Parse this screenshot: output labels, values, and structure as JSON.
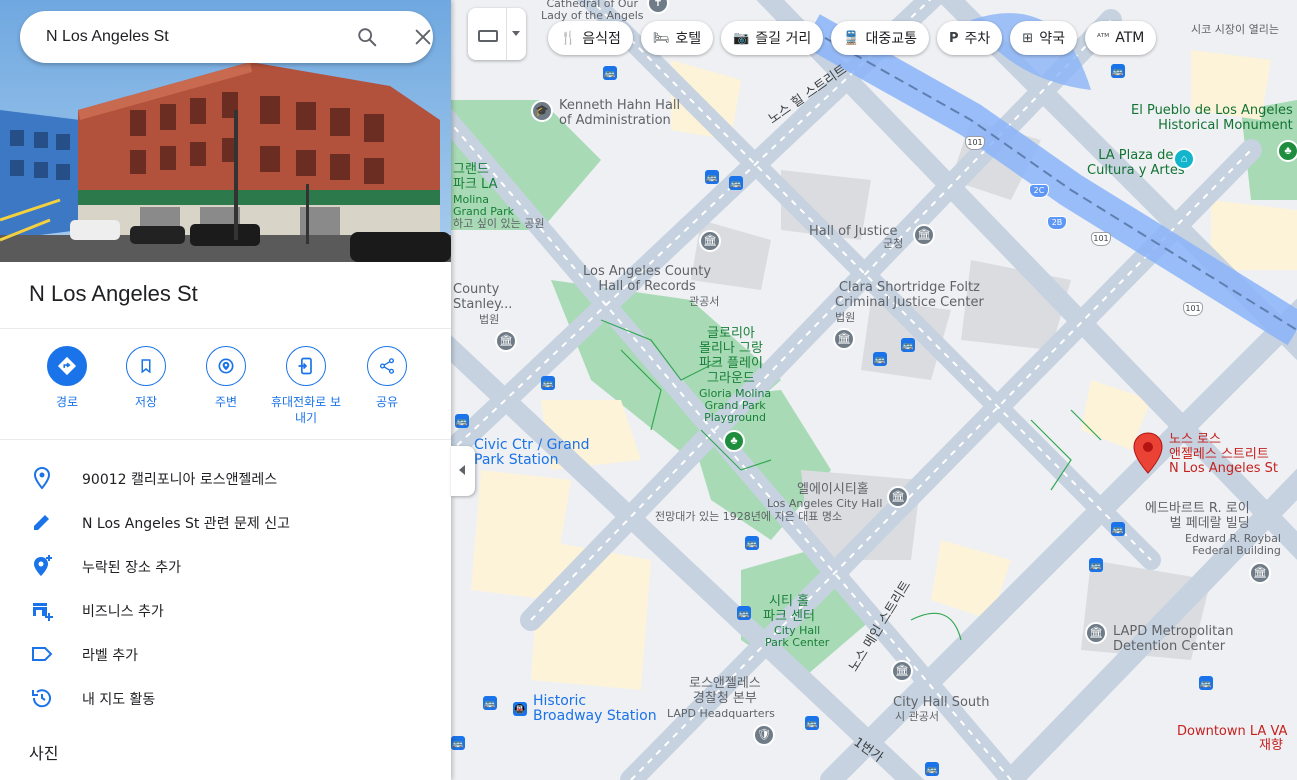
{
  "search": {
    "value": "N Los Angeles St"
  },
  "place": {
    "title": "N Los Angeles St"
  },
  "actions": [
    {
      "label": "경로",
      "icon": "directions-icon"
    },
    {
      "label": "저장",
      "icon": "bookmark-icon"
    },
    {
      "label": "주변",
      "icon": "nearby-icon"
    },
    {
      "label": "휴대전화로 보내기",
      "icon": "send-to-phone-icon"
    },
    {
      "label": "공유",
      "icon": "share-icon"
    }
  ],
  "info": [
    {
      "text": "90012 캘리포니아 로스앤젤레스",
      "icon": "location-pin-icon"
    },
    {
      "text": "N Los Angeles St 관련 문제 신고",
      "icon": "edit-pencil-icon"
    },
    {
      "text": "누락된 장소 추가",
      "icon": "add-place-icon"
    },
    {
      "text": "비즈니스 추가",
      "icon": "add-business-icon"
    },
    {
      "text": "라벨 추가",
      "icon": "label-icon"
    },
    {
      "text": "내 지도 활동",
      "icon": "history-icon"
    }
  ],
  "photos_heading": "사진",
  "chips": [
    {
      "label": "음식점",
      "icon": "restaurant-icon",
      "glyph": "🍴"
    },
    {
      "label": "호텔",
      "icon": "hotel-icon",
      "glyph": "🛏"
    },
    {
      "label": "즐길 거리",
      "icon": "camera-icon",
      "glyph": "📷"
    },
    {
      "label": "대중교통",
      "icon": "transit-icon",
      "glyph": "🚆"
    },
    {
      "label": "주차",
      "icon": "parking-icon",
      "glyph": "P"
    },
    {
      "label": "약국",
      "icon": "pharmacy-icon",
      "glyph": "⊞"
    },
    {
      "label": "ATM",
      "icon": "atm-icon",
      "glyph": "ᴬᵀᴹ"
    }
  ],
  "map": {
    "labels": {
      "cathedral": "Cathedral of Our\nLady of the Angels",
      "kenneth_hahn": "Kenneth Hahn Hall\nof Administration",
      "el_pueblo": "El Pueblo de Los Angeles\nHistorical Monument",
      "la_plaza": "LA Plaza de\nCultura y Artes",
      "hall_of_justice": "Hall of Justice",
      "hall_of_justice_sub": "군청",
      "clara_shortridge": "Clara Shortridge Foltz\nCriminal Justice Center",
      "clara_sub": "법원",
      "la_county_records": "Los Angeles County\nHall of Records",
      "la_county_records_sub": "관공서",
      "grand_park": "그랜드\n파크 LA",
      "grand_park_en": "Molina\nGrand Park",
      "grand_park_note": "하고 싶이 있는 공원",
      "county_stanley": "County\nStanley...",
      "county_stanley_sub": "법원",
      "gloria_molina_kr": "글로리아\n몰리나 그랑\n파크 플레이\n그라운드",
      "gloria_molina_en": "Gloria Molina\nGrand Park\nPlayground",
      "civic_ctr": "Civic Ctr / Grand\nPark Station",
      "la_city_hall_kr": "엘에이시티홀",
      "la_city_hall_en": "Los Angeles City Hall",
      "la_city_hall_note": "전망대가 있는 1928년에 지은 대표 명소",
      "n_los_angeles_kr": "노스 로스\n앤젤레스 스트리트",
      "n_los_angeles_en": "N Los Angeles St",
      "edward_roybal_kr": "에드바르트 R. 로이\n벌 페데랄 빌딩",
      "edward_roybal_en": "Edward R. Roybal\nFederal Building",
      "city_hall_park_kr": "시티 홀\n파크 센터",
      "city_hall_park_en": "City Hall\nPark Center",
      "lapd_metro": "LAPD Metropolitan\nDetention Center",
      "lapd_hq_kr": "로스앤젤레스\n경찰청 본부",
      "lapd_hq_en": "LAPD Headquarters",
      "historic_broadway": "Historic\nBroadway Station",
      "city_hall_south": "City Hall South",
      "city_hall_south_sub": "시 관공서",
      "downtown_la": "Downtown LA VA",
      "downtown_la_sub": "재향",
      "mayor_note": "시코 시장이 열리는",
      "hill_st": "노스 힐 스트리트",
      "main_st": "노스 메인 스트리트",
      "first_st": "1번가",
      "hwy_101": "101",
      "ramp_2c": "2C",
      "ramp_2b": "2B"
    }
  },
  "colors": {
    "accent": "#1a73e8",
    "pin": "#ea4335",
    "park": "#a8dab5",
    "highway": "#8ab4f8"
  }
}
